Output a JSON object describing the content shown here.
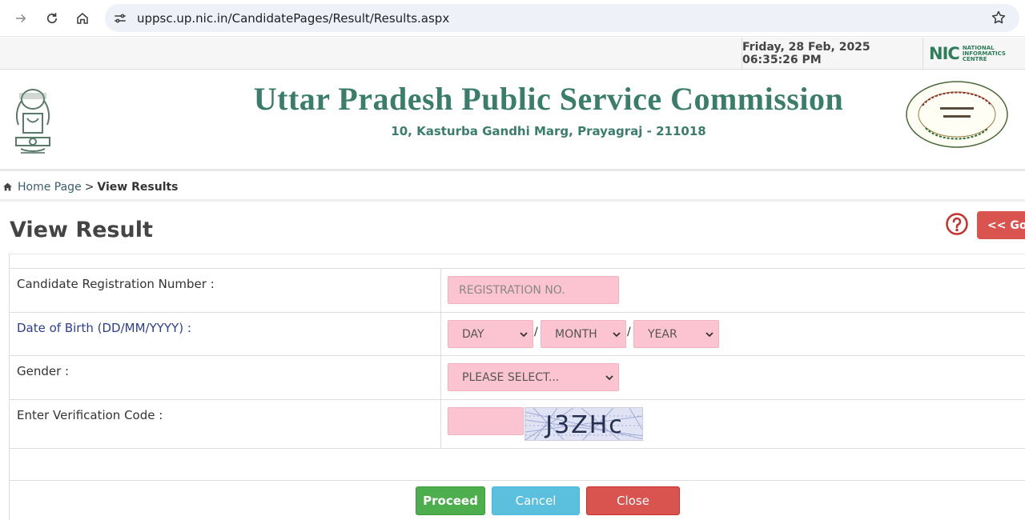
{
  "browser": {
    "url": "uppsc.up.nic.in/CandidatePages/Result/Results.aspx",
    "icons": [
      "forward-icon",
      "reload-icon",
      "home-icon",
      "site-settings-icon",
      "bookmark-star-icon"
    ]
  },
  "info_strip": {
    "datetime": "Friday, 28 Feb, 2025 06:35:26 PM",
    "nic_mark": "NIC",
    "nic_line1": "NATIONAL",
    "nic_line2": "INFORMATICS",
    "nic_line3": "CENTRE"
  },
  "header": {
    "title": "Uttar Pradesh Public Service Commission",
    "address": "10, Kasturba Gandhi Marg, Prayagraj - 211018"
  },
  "breadcrumb": {
    "home": "Home Page",
    "separator": ">",
    "current": "View Results"
  },
  "page": {
    "title": "View Result",
    "go_back_label": "<< Go Back"
  },
  "form": {
    "registration_label": "Candidate Registration Number :",
    "registration_placeholder": "REGISTRATION NO.",
    "dob_label": "Date of Birth (DD/MM/YYYY) :",
    "dob_day": "DAY",
    "dob_month": "MONTH",
    "dob_year": "YEAR",
    "dob_separator": "/",
    "gender_label": "Gender :",
    "gender_selected": "PLEASE SELECT...",
    "captcha_label": "Enter Verification Code :",
    "captcha_value": "J3ZHc"
  },
  "buttons": {
    "proceed": "Proceed",
    "cancel": "Cancel",
    "close": "Close"
  },
  "colors": {
    "brand_green": "#3a7d6a",
    "input_pink": "#fbc4d0",
    "proceed": "#4cae4c",
    "cancel": "#5bc0de",
    "close": "#d9534f"
  }
}
